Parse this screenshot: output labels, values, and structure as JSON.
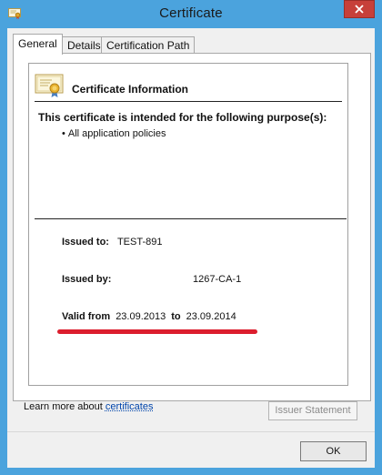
{
  "window": {
    "title": "Certificate",
    "close_symbol": "✕"
  },
  "tabs": [
    {
      "label": "General",
      "active": true
    },
    {
      "label": "Details",
      "active": false
    },
    {
      "label": "Certification Path",
      "active": false
    }
  ],
  "info": {
    "heading": "Certificate Information",
    "purpose_heading": "This certificate is intended for the following purpose(s):",
    "purposes": [
      "All application policies"
    ],
    "bullet": "•",
    "issued_to_label": "Issued to:",
    "issued_to_value": "TEST-891",
    "issued_by_label": "Issued by:",
    "issued_by_value": "1267-CA-1",
    "valid_from_label": "Valid from",
    "valid_from_value": "23.09.2013",
    "valid_to_label": "to",
    "valid_to_value": "23.09.2014"
  },
  "buttons": {
    "issuer_statement": "Issuer Statement",
    "ok": "OK"
  },
  "learn_more": {
    "prefix": "Learn more about ",
    "link": "certificates"
  },
  "colors": {
    "window_frame": "#4ba3dd",
    "close_button": "#c7403a",
    "highlight_underline": "#dc1e2e",
    "link": "#0044aa"
  },
  "icons": {
    "title": "certificate-small-icon",
    "info": "certificate-ribbon-icon",
    "close": "close-icon"
  }
}
